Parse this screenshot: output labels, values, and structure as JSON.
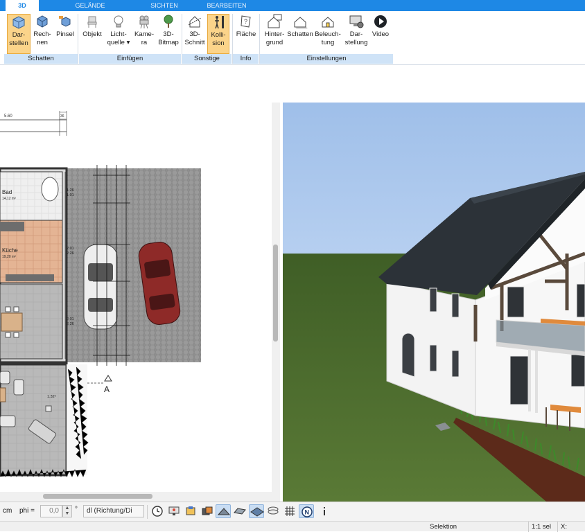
{
  "tabs": [
    {
      "label": "3D",
      "active": true
    },
    {
      "label": "GELÄNDE",
      "active": false
    },
    {
      "label": "SICHTEN",
      "active": false
    },
    {
      "label": "BEARBEITEN",
      "active": false
    }
  ],
  "ribbon": {
    "buttons": {
      "darstellen": {
        "line1": "Dar-",
        "line2": "stellen",
        "active": true,
        "icon": "cube-display-icon"
      },
      "rechnen": {
        "line1": "Rech-",
        "line2": "nen",
        "icon": "cube-calc-icon"
      },
      "pinsel": {
        "line1": "Pinsel",
        "line2": "",
        "icon": "paint-cube-icon"
      },
      "objekt": {
        "line1": "Objekt",
        "line2": "",
        "icon": "chair-icon"
      },
      "lichtquelle": {
        "line1": "Licht-",
        "line2": "quelle ▾",
        "icon": "lightbulb-icon"
      },
      "kamera": {
        "line1": "Kame-",
        "line2": "ra",
        "icon": "camera-icon"
      },
      "bitmap3d": {
        "line1": "3D-",
        "line2": "Bitmap",
        "icon": "tree-icon"
      },
      "schnitt3d": {
        "line1": "3D-",
        "line2": "Schnitt",
        "icon": "cut-house-icon"
      },
      "kollision": {
        "line1": "Kolli-",
        "line2": "sion",
        "active": true,
        "icon": "person-collision-icon"
      },
      "flaeche": {
        "line1": "Fläche",
        "line2": "",
        "icon": "area-icon"
      },
      "hintergrund": {
        "line1": "Hinter-",
        "line2": "grund",
        "icon": "house-bg-icon"
      },
      "schatten": {
        "line1": "Schatten",
        "line2": "",
        "icon": "house-shadow-icon"
      },
      "beleuchtung": {
        "line1": "Beleuch-",
        "line2": "tung",
        "icon": "house-light-icon"
      },
      "darstellung": {
        "line1": "Dar-",
        "line2": "stellung",
        "icon": "monitor-settings-icon"
      },
      "video": {
        "line1": "Video",
        "line2": "",
        "icon": "play-icon"
      }
    },
    "groups": {
      "schatten": "Schatten",
      "einfuegen": "Einfügen",
      "sonstige": "Sonstige",
      "info": "Info",
      "einstellungen": "Einstellungen"
    }
  },
  "plan": {
    "dim_top": "5.60",
    "dim_top_right": "36",
    "rooms": [
      {
        "name": "Bad",
        "area": "14,12 m²"
      },
      {
        "name": "Küche",
        "area": "19,20 m²"
      }
    ],
    "section_marker": "A",
    "dims_right": [
      "1.26",
      "1.01",
      "2.01",
      "2.26",
      "2.01",
      "2.26"
    ],
    "dim_small": "1.32²"
  },
  "bottombar": {
    "unit": "cm",
    "phi_label": "phi =",
    "phi_value": "0,0",
    "degree": "°",
    "direction": "dl (Richtung/Di"
  },
  "statusbar": {
    "mode": "Selektion",
    "scale": "1:1 sel",
    "x_label": "X:"
  },
  "colors": {
    "tab_bar": "#1e88e5",
    "ribbon_group": "#cfe3f7",
    "active_button": "#fbd48a",
    "sky": "#a9c6ec",
    "grass": "#4d6b2e",
    "roof": "#2c3238",
    "wall": "#f5f5f5",
    "timber": "#5a4a3c"
  }
}
